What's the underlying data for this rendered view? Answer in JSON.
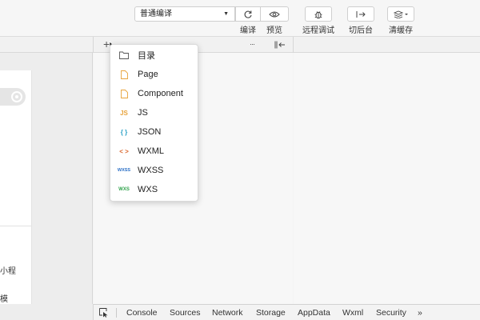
{
  "toolbar": {
    "compile_mode": "普通编译",
    "buttons": [
      {
        "label": "编译",
        "icon": "refresh-icon"
      },
      {
        "label": "预览",
        "icon": "eye-icon"
      },
      {
        "label": "远程调试",
        "icon": "bug-icon"
      },
      {
        "label": "切后台",
        "icon": "switch-background-icon"
      },
      {
        "label": "清缓存",
        "icon": "layers-icon"
      }
    ]
  },
  "subbar": {
    "add_symbol": "+",
    "more_symbol": "···"
  },
  "new_menu": {
    "items": [
      {
        "label": "目录",
        "icon": "folder-icon",
        "icon_text": "",
        "color": "#555555"
      },
      {
        "label": "Page",
        "icon": "page-file-icon",
        "icon_text": "",
        "color": "#e8a33c"
      },
      {
        "label": "Component",
        "icon": "component-file-icon",
        "icon_text": "",
        "color": "#e8a33c"
      },
      {
        "label": "JS",
        "icon": "js-file-icon",
        "icon_text": "JS",
        "color": "#e8a33c"
      },
      {
        "label": "JSON",
        "icon": "json-file-icon",
        "icon_text": "{ }",
        "color": "#2aa1c6"
      },
      {
        "label": "WXML",
        "icon": "wxml-file-icon",
        "icon_text": "< >",
        "color": "#d9652b"
      },
      {
        "label": "WXSS",
        "icon": "wxss-file-icon",
        "icon_text": "WXSS",
        "color": "#2a6fc6"
      },
      {
        "label": "WXS",
        "icon": "wxs-file-icon",
        "icon_text": "WXS",
        "color": "#2fa24b"
      }
    ]
  },
  "simulator": {
    "text_1": "小程",
    "text_2": "模"
  },
  "devtools_tabs": [
    "Console",
    "Sources",
    "Network",
    "Storage",
    "AppData",
    "Wxml",
    "Security",
    "»"
  ]
}
